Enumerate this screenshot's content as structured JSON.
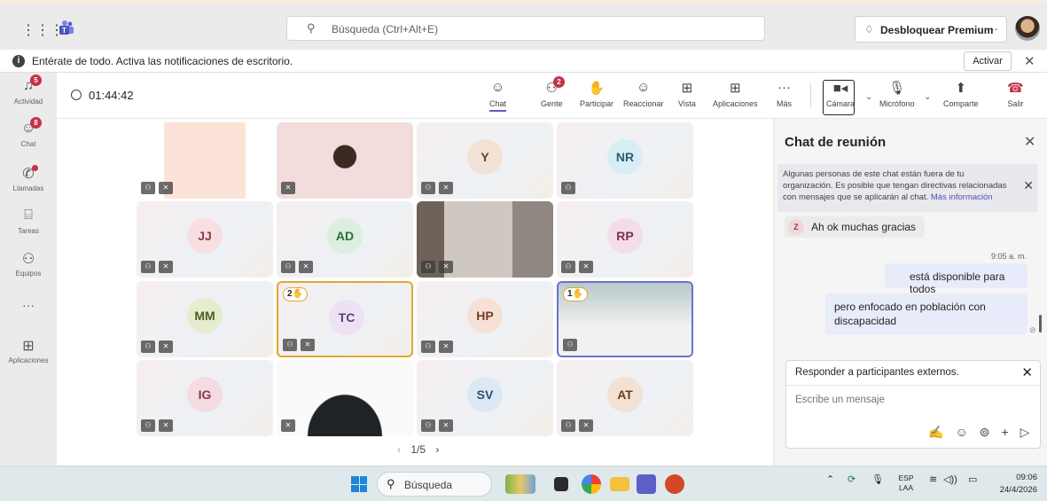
{
  "titlebar": {
    "search_placeholder": "Búsqueda (Ctrl+Alt+E)",
    "premium_label": "Desbloquear Premium",
    "more": "···"
  },
  "notification": {
    "text": "Entérate de todo. Activa las notificaciones de escritorio.",
    "action": "Activar"
  },
  "rail": {
    "items": [
      {
        "label": "Actividad",
        "badge": "5"
      },
      {
        "label": "Chat",
        "badge": "8"
      },
      {
        "label": "Llamadas"
      },
      {
        "label": "Tareas"
      },
      {
        "label": "Equipos"
      },
      {
        "label": "···"
      },
      {
        "label": "Aplicaciones"
      }
    ]
  },
  "meeting": {
    "timer": "01:44:42",
    "toolbar": {
      "chat": "Chat",
      "people": "Gente",
      "people_badge": "2",
      "raise": "Participar",
      "react": "Reaccionar",
      "view": "Vista",
      "apps": "Aplicaciones",
      "more": "Más",
      "camera": "Cámara",
      "mic": "Micrófono",
      "share": "Comparte",
      "leave": "Salir"
    },
    "tiles": [
      {
        "initials": "",
        "kind": "video"
      },
      {
        "initials": "",
        "kind": "photo"
      },
      {
        "initials": "Y"
      },
      {
        "initials": "NR"
      },
      {
        "initials": "JJ"
      },
      {
        "initials": "AD"
      },
      {
        "initials": "",
        "kind": "video"
      },
      {
        "initials": "RP"
      },
      {
        "initials": "MM"
      },
      {
        "initials": "TC",
        "hand": "2"
      },
      {
        "initials": "HP"
      },
      {
        "initials": "",
        "kind": "video",
        "hand": "1"
      },
      {
        "initials": "IG"
      },
      {
        "initials": "",
        "kind": "video"
      },
      {
        "initials": "SV"
      },
      {
        "initials": "AT"
      }
    ],
    "pager": "1/5"
  },
  "chat": {
    "title": "Chat de reunión",
    "warning": "Algunas personas de este chat están fuera de tu organización. Es posible que tengan directivas relacionadas con mensajes que se aplicarán al chat.",
    "warning_link": "Más información",
    "incoming_initial": "Z",
    "incoming": "Ah ok muchas gracias",
    "timestamp": "9:05 a. m.",
    "outgoing1": "está disponible para todos",
    "outgoing2": "pero enfocado en población con discapacidad",
    "reply_header": "Responder a participantes externos.",
    "input_placeholder": "Escribe un mensaje"
  },
  "taskbar": {
    "search": "Búsqueda",
    "lang_top": "ESP",
    "lang_bottom": "LAA",
    "time": "09:06",
    "date": "24/4/2026"
  },
  "colors": {
    "brand": "#5b5fc7",
    "leave": "#c4314b",
    "badge": "#c4314b",
    "raised_hand": "#e0a82e"
  }
}
